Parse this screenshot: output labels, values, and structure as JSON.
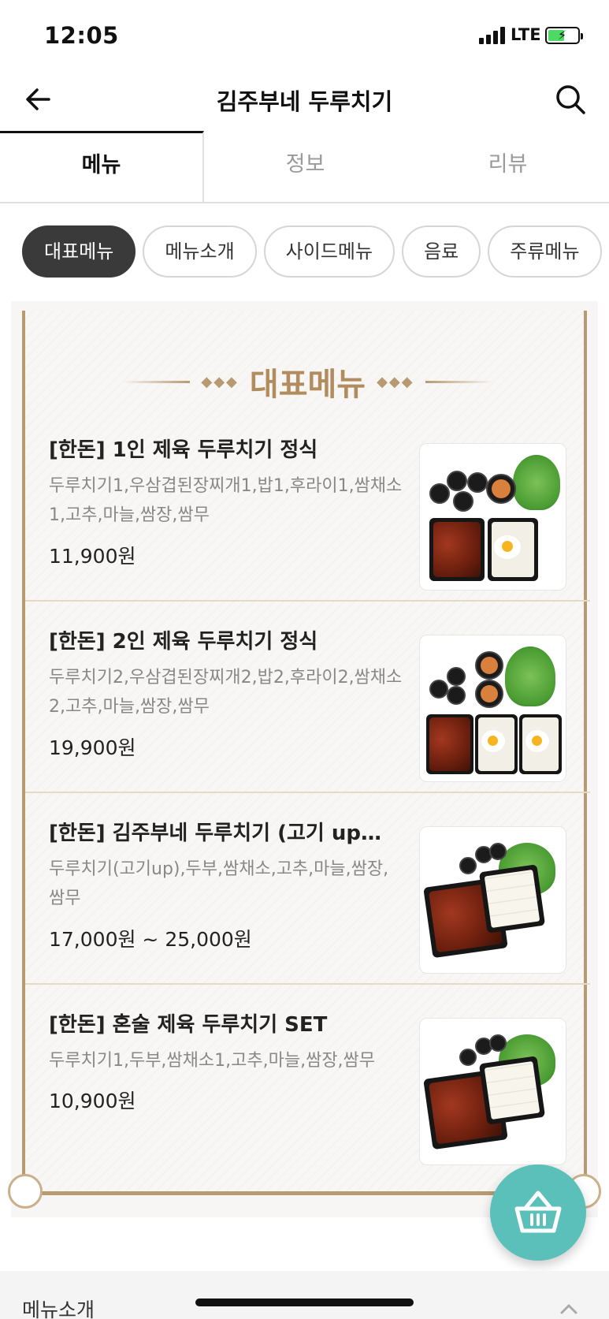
{
  "status_bar": {
    "time": "12:05",
    "network": "LTE",
    "battery_level": 0.55,
    "icons": [
      "signal-icon",
      "battery-charging-icon"
    ]
  },
  "header": {
    "title": "김주부네 두루치기",
    "back_icon": "arrow-left-icon",
    "search_icon": "search-icon"
  },
  "tabs": [
    {
      "label": "메뉴",
      "active": true
    },
    {
      "label": "정보",
      "active": false
    },
    {
      "label": "리뷰",
      "active": false
    }
  ],
  "chips": [
    {
      "label": "대표메뉴",
      "active": true
    },
    {
      "label": "메뉴소개",
      "active": false
    },
    {
      "label": "사이드메뉴",
      "active": false
    },
    {
      "label": "음료",
      "active": false
    },
    {
      "label": "주류메뉴",
      "active": false
    }
  ],
  "board": {
    "title": "대표메뉴",
    "items": [
      {
        "name": "[한돈] 1인 제육 두루치기 정식",
        "description": "두루치기1,우삼겹된장찌개1,밥1,후라이1,쌈채소1,고추,마늘,쌈장,쌈무",
        "price": "11,900원"
      },
      {
        "name": "[한돈] 2인 제육 두루치기 정식",
        "description": "두루치기2,우삼겹된장찌개2,밥2,후라이2,쌈채소2,고추,마늘,쌈장,쌈무",
        "price": "19,900원"
      },
      {
        "name": "[한돈] 김주부네 두루치기 (고기 up…",
        "description": "두루치기(고기up),두부,쌈채소,고추,마늘,쌈장,쌈무",
        "price": "17,000원 ~ 25,000원"
      },
      {
        "name": "[한돈] 혼술 제육 두루치기 SET",
        "description": "두루치기1,두부,쌈채소1,고추,마늘,쌈장,쌈무",
        "price": "10,900원"
      }
    ]
  },
  "cart": {
    "icon": "basket-icon",
    "color": "#5bbfba"
  },
  "bottom_sheet": {
    "label": "메뉴소개",
    "icon": "chevron-up-icon"
  },
  "colors": {
    "accent_gold": "#b79a72",
    "chip_active": "#3a3a3a"
  }
}
